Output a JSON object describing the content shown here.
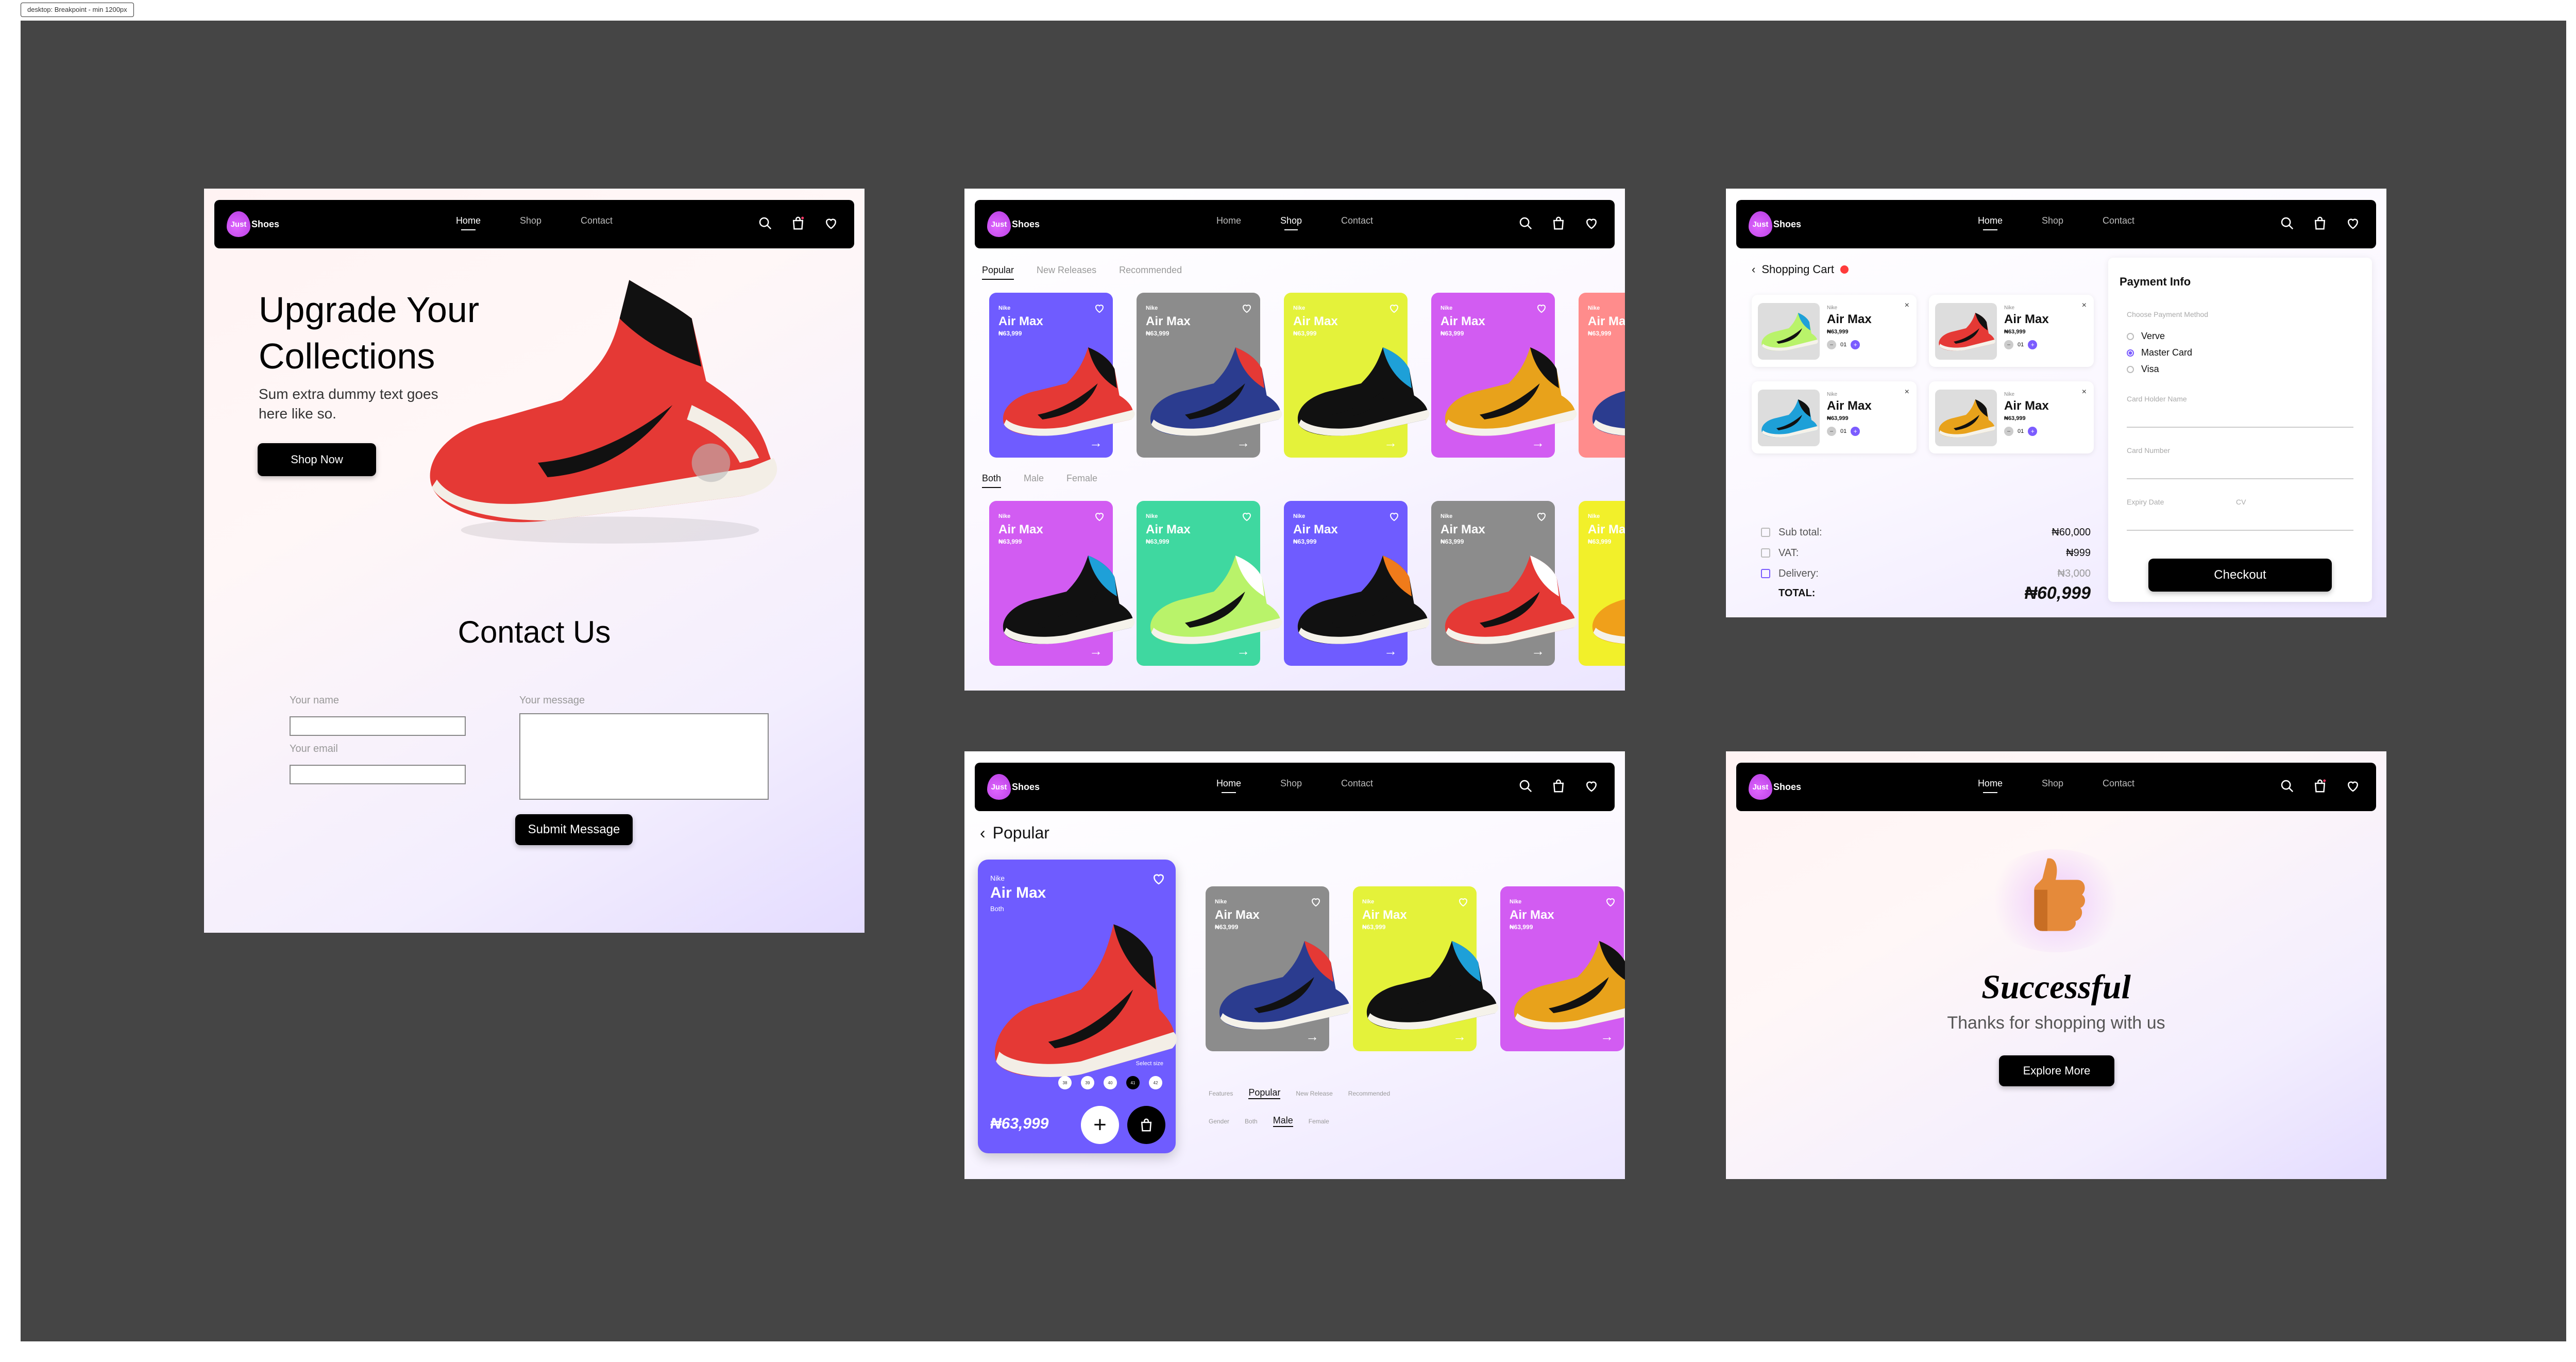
{
  "frame_label": "desktop: Breakpoint - min 1200px",
  "brand": {
    "logo_mark": "Just",
    "logo_word": "Shoes"
  },
  "nav": {
    "home": "Home",
    "shop": "Shop",
    "contact": "Contact"
  },
  "home": {
    "hero_title_line1": "Upgrade Your",
    "hero_title_line2": "Collections",
    "hero_sub_line1": "Sum extra dummy text goes",
    "hero_sub_line2": "here like so.",
    "shop_now": "Shop Now",
    "contact_title": "Contact Us",
    "name_label": "Your name",
    "email_label": "Your email",
    "message_label": "Your message",
    "submit": "Submit Message"
  },
  "shop": {
    "tabs_top": [
      "Popular",
      "New Releases",
      "Recommended"
    ],
    "tabs_gender": [
      "Both",
      "Male",
      "Female"
    ],
    "card_brand": "Nike",
    "card_name": "Air Max",
    "card_price": "₦63,999"
  },
  "cart": {
    "back_label": "Shopping Cart",
    "item_brand": "Nike",
    "item_name": "Air Max",
    "item_price": "₦63,999",
    "qty": "01",
    "sub_total_label": "Sub total:",
    "sub_total_value": "₦60,000",
    "vat_label": "VAT:",
    "vat_value": "₦999",
    "delivery_label": "Delivery:",
    "delivery_value": "₦3,000",
    "total_label": "TOTAL:",
    "total_value": "₦60,999",
    "payment_title": "Payment Info",
    "choose_method": "Choose Payment Method",
    "methods": [
      "Verve",
      "Master Card",
      "Visa"
    ],
    "card_holder": "Card Holder Name",
    "card_number": "Card Number",
    "expiry": "Expiry Date",
    "cv": "CV",
    "checkout": "Checkout"
  },
  "detail": {
    "back_label": "Popular",
    "brand": "Nike",
    "name": "Air Max",
    "gender": "Both",
    "select_size": "Select size",
    "sizes": [
      "38",
      "39",
      "40",
      "41",
      "42"
    ],
    "price": "₦63,999",
    "tabs_kind": [
      "Features",
      "Popular",
      "New Release",
      "Recommended"
    ],
    "tabs_gender_label": "Gender",
    "tabs_gender": [
      "Both",
      "Male",
      "Female"
    ]
  },
  "success": {
    "title": "Successful",
    "subtitle": "Thanks for shopping with us",
    "explore": "Explore More"
  },
  "colors": {
    "violet": "#6f5cff",
    "gray": "#8c8c8c",
    "lime": "#e4f23a",
    "magenta": "#d25cf2",
    "salmon": "#ff8c8c",
    "mint": "#3fd8a0",
    "yellow": "#f2f02a"
  }
}
